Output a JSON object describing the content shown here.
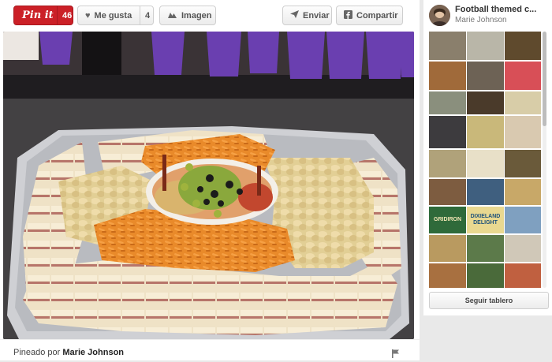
{
  "toolbar": {
    "pin_it_label": "Pin it",
    "pin_count": "46",
    "like_label": "Me gusta",
    "like_count": "4",
    "image_label": "Imagen",
    "send_label": "Enviar",
    "share_label": "Compartir"
  },
  "pin": {
    "pinned_by_prefix": "Pineado por",
    "pinned_by_user": "Marie Johnson"
  },
  "board": {
    "title": "Football themed c...",
    "owner": "Marie Johnson",
    "follow_label": "Seguir tablero",
    "thumbnails": [
      {
        "text": "",
        "color": "#8a7f6c"
      },
      {
        "text": "",
        "color": "#b9b6a8"
      },
      {
        "text": "",
        "color": "#5f4a2d"
      },
      {
        "text": "",
        "color": "#a06a3a"
      },
      {
        "text": "",
        "color": "#6d6255"
      },
      {
        "text": "",
        "color": "#d84f57"
      },
      {
        "text": "",
        "color": "#8a8f7d"
      },
      {
        "text": "",
        "color": "#4a3a2a"
      },
      {
        "text": "",
        "color": "#d8cda8"
      },
      {
        "text": "",
        "color": "#3d3b3e"
      },
      {
        "text": "",
        "color": "#c9b87a"
      },
      {
        "text": "",
        "color": "#d9c9b0"
      },
      {
        "text": "",
        "color": "#b0a27a"
      },
      {
        "text": "",
        "color": "#e8e0c8"
      },
      {
        "text": "",
        "color": "#6a5a3a"
      },
      {
        "text": "",
        "color": "#7d5c40"
      },
      {
        "text": "",
        "color": "#3f5f7f"
      },
      {
        "text": "",
        "color": "#c8a868"
      },
      {
        "text": "GRIDIRON",
        "color": "#2f6a3a"
      },
      {
        "text": "DIXIELAND DELIGHT",
        "color": "#e9d890"
      },
      {
        "text": "",
        "color": "#7fa0c0"
      },
      {
        "text": "",
        "color": "#b99a60"
      },
      {
        "text": "",
        "color": "#5c7a4a"
      },
      {
        "text": "",
        "color": "#d0c8b8"
      },
      {
        "text": "",
        "color": "#a87040"
      },
      {
        "text": "",
        "color": "#4a6a3a"
      },
      {
        "text": "",
        "color": "#c06040"
      }
    ]
  }
}
